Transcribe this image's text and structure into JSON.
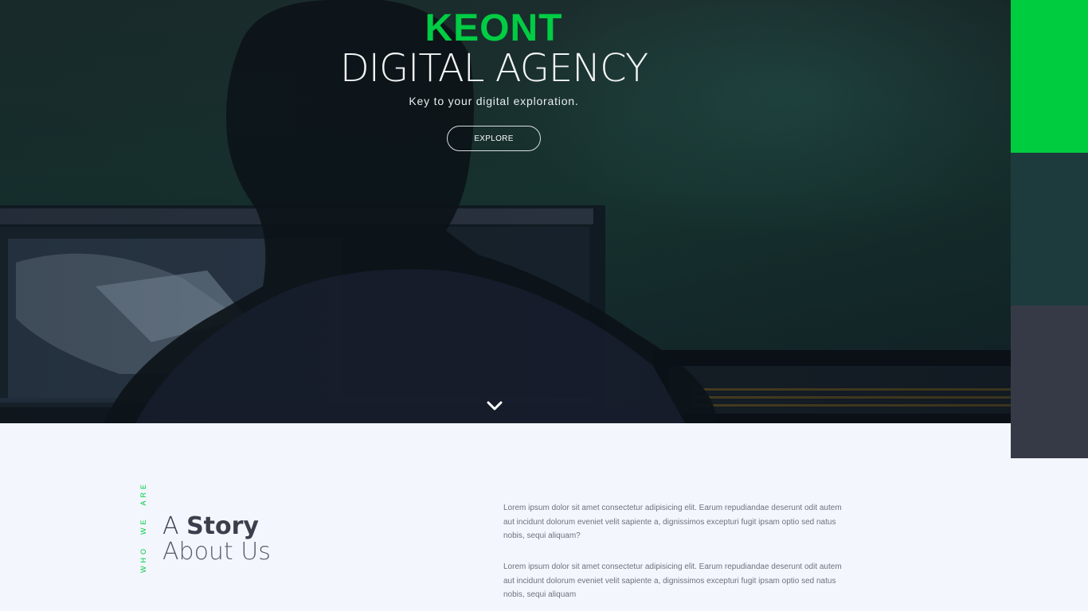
{
  "hero": {
    "brand": "KEONT",
    "headline": "DIGITAL AGENCY",
    "tagline": "Key to your digital exploration.",
    "explore_label": "EXPLORE",
    "scroll_icon": "chevron-down-icon"
  },
  "colors": {
    "accent": "#00cc3f",
    "panel_teal": "#1d3b3c",
    "panel_slate": "#363a47",
    "section_bg": "#f3f6fd"
  },
  "about": {
    "label_words": [
      "WHO",
      "WE",
      "ARE"
    ],
    "heading_prefix": "A",
    "heading_bold": "Story",
    "heading_line2": "About Us",
    "paragraphs": [
      "Lorem ipsum dolor sit amet consectetur adipisicing elit. Earum repudiandae deserunt odit autem aut incidunt dolorum eveniet velit sapiente a, dignissimos excepturi fugit ipsam optio sed natus nobis, sequi aliquam?",
      "Lorem ipsum dolor sit amet consectetur adipisicing elit. Earum repudiandae deserunt odit autem aut incidunt dolorum eveniet velit sapiente a, dignissimos excepturi fugit ipsam optio sed natus nobis, sequi aliquam"
    ]
  }
}
